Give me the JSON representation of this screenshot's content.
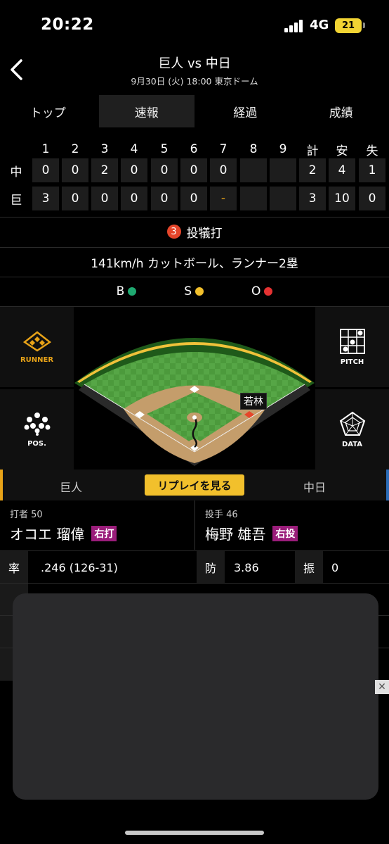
{
  "status": {
    "time": "20:22",
    "network": "4G",
    "battery": "21"
  },
  "header": {
    "title": "巨人 vs 中日",
    "subtitle": "9月30日 (火) 18:00 東京ドーム"
  },
  "tabs": [
    "トップ",
    "速報",
    "経過",
    "成績"
  ],
  "scoreboard": {
    "columns": [
      "1",
      "2",
      "3",
      "4",
      "5",
      "6",
      "7",
      "8",
      "9",
      "計",
      "安",
      "失"
    ],
    "rows": [
      {
        "team": "中",
        "cells": [
          "0",
          "0",
          "2",
          "0",
          "0",
          "0",
          "0",
          "",
          "",
          "2",
          "4",
          "1"
        ]
      },
      {
        "team": "巨",
        "cells": [
          "3",
          "0",
          "0",
          "0",
          "0",
          "0",
          "-",
          "",
          "",
          "3",
          "10",
          "0"
        ]
      }
    ]
  },
  "play": {
    "out_number": "3",
    "result": "投犠打",
    "pitch_desc": "141km/h カットボール、ランナー2塁",
    "count": {
      "b": "B",
      "s": "S",
      "o": "O"
    }
  },
  "colors": {
    "ball": "#1fa971",
    "strike": "#f2c02c",
    "out": "#e53232",
    "accent": "#e8a318"
  },
  "field": {
    "buttons": {
      "runner": "RUNNER",
      "pitch": "PITCH",
      "pos": "POS.",
      "data": "DATA"
    },
    "runner_label": "若林"
  },
  "team_bar": {
    "left": "巨人",
    "replay": "リプレイを見る",
    "right": "中日"
  },
  "batter": {
    "role": "打者 50",
    "name": "オコエ 瑠偉",
    "hand": "右打"
  },
  "pitcher": {
    "role": "投手 46",
    "name": "梅野 雄吾",
    "hand": "右投"
  },
  "stats": {
    "batter_avg_key": "率",
    "batter_avg_val": ".246 (126-31)",
    "pitcher_era_key": "防",
    "pitcher_era_val": "3.86",
    "pitcher_k_key": "振",
    "pitcher_k_val": "0"
  },
  "icons": [
    "back-chevron-icon",
    "signal-icon",
    "battery-icon",
    "runner-diamond-icon",
    "pitch-grid-icon",
    "positions-icon",
    "radar-icon",
    "close-icon"
  ]
}
